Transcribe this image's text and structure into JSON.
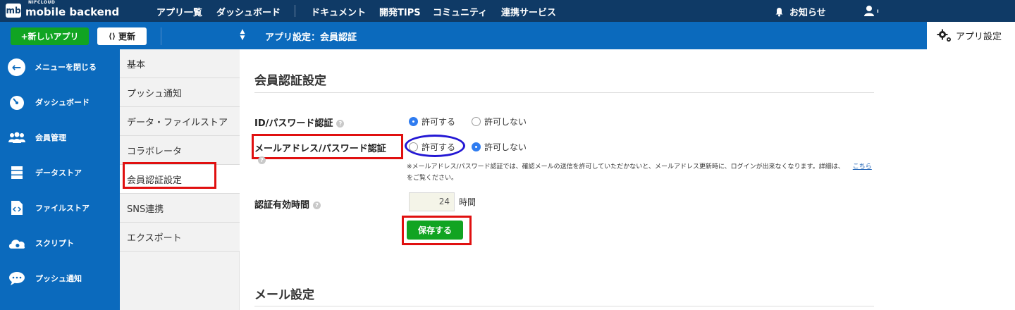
{
  "header": {
    "logo_badge": "mb",
    "logo_sub": "NIFCLOUD",
    "logo_text": "mobile backend",
    "nav": [
      "アプリ一覧",
      "ダッシュボード",
      "ドキュメント",
      "開発TIPS",
      "コミュニティ",
      "連携サービス"
    ],
    "notifications": "お知らせ",
    "user_icon": "user-icon"
  },
  "toolbar": {
    "new_app": "+新しいアプリ",
    "refresh": "更新",
    "breadcrumb": "アプリ設定：会員認証",
    "settings_tab": "アプリ設定"
  },
  "sidebar": {
    "items": [
      {
        "label": "メニューを閉じる",
        "icon": "arrow-left-icon"
      },
      {
        "label": "ダッシュボード",
        "icon": "gauge-icon"
      },
      {
        "label": "会員管理",
        "icon": "users-icon"
      },
      {
        "label": "データストア",
        "icon": "database-icon"
      },
      {
        "label": "ファイルストア",
        "icon": "file-code-icon"
      },
      {
        "label": "スクリプト",
        "icon": "cloud-gear-icon"
      },
      {
        "label": "プッシュ通知",
        "icon": "chat-bubble-icon"
      }
    ]
  },
  "submenu": {
    "items": [
      "基本",
      "プッシュ通知",
      "データ・ファイルストア",
      "コラボレータ",
      "会員認証設定",
      "SNS連携",
      "エクスポート"
    ],
    "active_index": 4
  },
  "main": {
    "section1_title": "会員認証設定",
    "id_password": {
      "label": "ID/パスワード認証",
      "allow": "許可する",
      "deny": "許可しない",
      "selected": "allow"
    },
    "mail_password": {
      "label": "メールアドレス/パスワード認証",
      "allow": "許可する",
      "deny": "許可しない",
      "selected": "deny"
    },
    "note": "※メールアドレス/パスワード認証では、確認メールの送信を許可していただかないと、メールアドレス更新時に、ログインが出来なくなります。詳細は、",
    "note_link": "こちら",
    "note_end": "をご覧ください。",
    "expiry": {
      "label": "認証有効時間",
      "value": "24",
      "unit": "時間"
    },
    "save_button": "保存する",
    "section2_title": "メール設定"
  },
  "colors": {
    "topbar": "#0f3a66",
    "accent_blue": "#0b6abd",
    "green": "#11a422",
    "annotation_red": "#e01010",
    "annotation_blue": "#2317d4"
  }
}
